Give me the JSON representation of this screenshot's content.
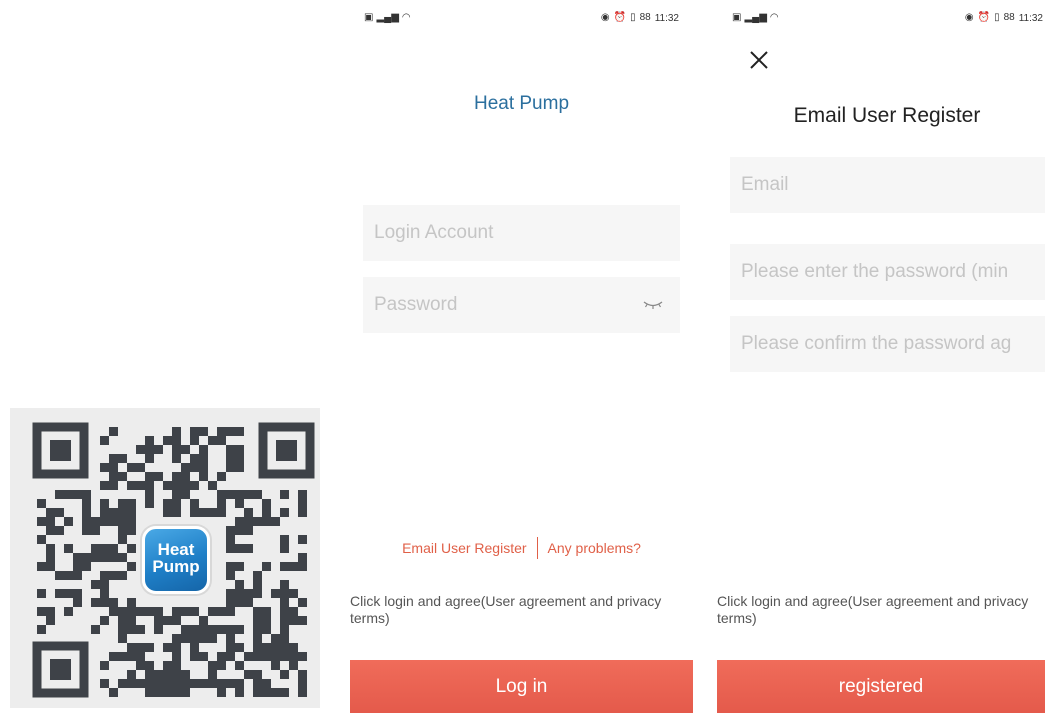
{
  "status_bar": {
    "left_icons": [
      "sim-icon",
      "signal-icon",
      "wifi-icon"
    ],
    "right_icons": [
      "eye-care-icon",
      "alarm-icon",
      "vibrate-icon",
      "battery-icon"
    ],
    "battery": "88",
    "time": "11:32"
  },
  "qr": {
    "app_icon_line1": "Heat",
    "app_icon_line2": "Pump"
  },
  "login": {
    "title": "Heat Pump",
    "account_placeholder": "Login Account",
    "password_placeholder": "Password",
    "link_register": "Email User Register",
    "link_problems": "Any problems?",
    "agree_text": "Click login and agree(User agreement and privacy terms)",
    "button_label": "Log in"
  },
  "register": {
    "title": "Email User Register",
    "email_placeholder": "Email",
    "password_placeholder": "Please enter the password (min",
    "confirm_placeholder": "Please confirm the password ag",
    "agree_text": "Click login and agree(User agreement and privacy terms)",
    "button_label": "registered"
  },
  "colors": {
    "accent": "#e45a4b",
    "link": "#e06048",
    "title_blue": "#2b6f9e",
    "field_bg": "#f6f6f6"
  }
}
